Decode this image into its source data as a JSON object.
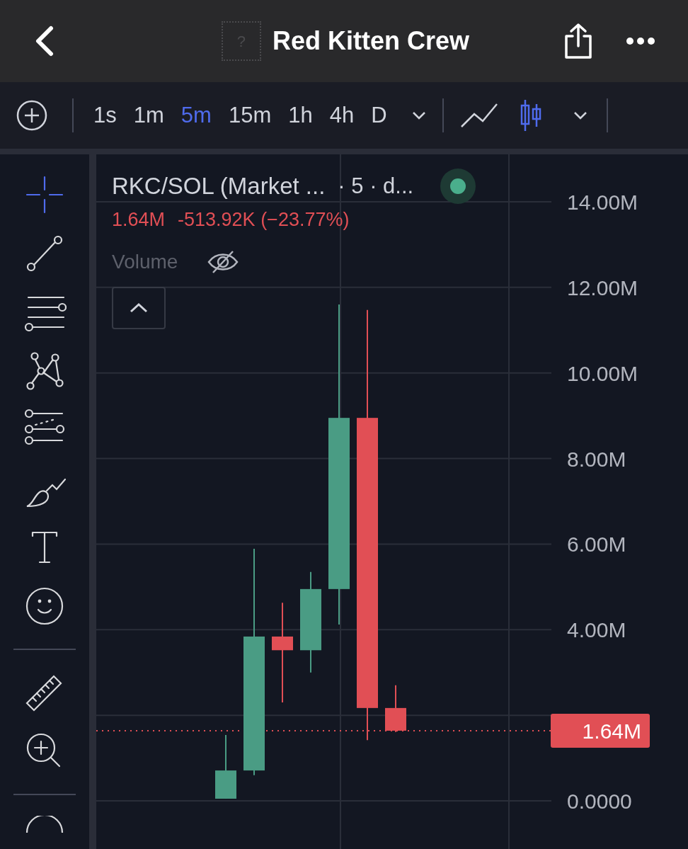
{
  "header": {
    "token_placeholder": "?",
    "title": "Red Kitten Crew"
  },
  "toolbar": {
    "intervals": [
      {
        "label": "1s",
        "selected": false
      },
      {
        "label": "1m",
        "selected": false
      },
      {
        "label": "5m",
        "selected": true
      },
      {
        "label": "15m",
        "selected": false
      },
      {
        "label": "1h",
        "selected": false
      },
      {
        "label": "4h",
        "selected": false
      },
      {
        "label": "D",
        "selected": false
      }
    ],
    "chart_types": [
      {
        "kind": "line",
        "selected": false
      },
      {
        "kind": "candles",
        "selected": true
      }
    ]
  },
  "tools": [
    {
      "kind": "crosshair",
      "selected": true
    },
    {
      "kind": "trend-line",
      "selected": false
    },
    {
      "kind": "parallel-lines",
      "selected": false
    },
    {
      "kind": "pattern",
      "selected": false
    },
    {
      "kind": "fib",
      "selected": false
    },
    {
      "kind": "brush",
      "selected": false
    },
    {
      "kind": "text",
      "selected": false
    },
    {
      "kind": "emoji",
      "selected": false
    },
    {
      "kind": "divider"
    },
    {
      "kind": "ruler",
      "selected": false
    },
    {
      "kind": "zoom",
      "selected": false
    },
    {
      "kind": "divider"
    }
  ],
  "legend": {
    "symbol": "RKC/SOL (Market ...",
    "interval": "· 5 · d...",
    "live": true,
    "price": "1.64M",
    "change": "-513.92K (−23.77%)",
    "volume_label": "Volume",
    "volume_visible": false
  },
  "price_axis": [
    "14.00M",
    "12.00M",
    "10.00M",
    "8.00M",
    "6.00M",
    "4.00M",
    "0.0000"
  ],
  "price_tag": "1.64M"
}
